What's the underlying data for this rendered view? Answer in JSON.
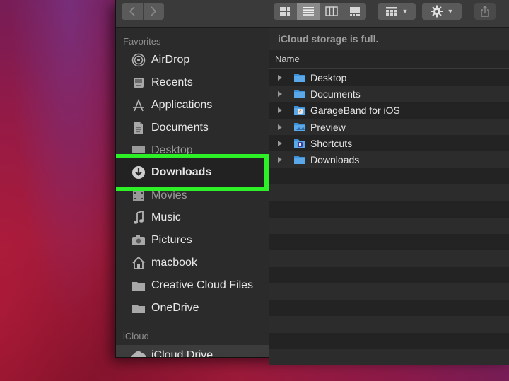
{
  "sidebar": {
    "favorites_title": "Favorites",
    "icloud_title": "iCloud",
    "items": [
      {
        "label": "AirDrop",
        "icon": "airdrop-icon"
      },
      {
        "label": "Recents",
        "icon": "recents-icon"
      },
      {
        "label": "Applications",
        "icon": "applications-icon"
      },
      {
        "label": "Documents",
        "icon": "documents-icon"
      },
      {
        "label": "Desktop",
        "icon": "desktop-icon"
      },
      {
        "label": "Downloads",
        "icon": "downloads-icon"
      },
      {
        "label": "Movies",
        "icon": "movies-icon"
      },
      {
        "label": "Music",
        "icon": "music-icon"
      },
      {
        "label": "Pictures",
        "icon": "pictures-icon"
      },
      {
        "label": "macbook",
        "icon": "home-icon"
      },
      {
        "label": "Creative Cloud Files",
        "icon": "folder-icon"
      },
      {
        "label": "OneDrive",
        "icon": "folder-icon"
      }
    ],
    "icloud_items": [
      {
        "label": "iCloud Drive",
        "icon": "icloud-icon"
      }
    ]
  },
  "main": {
    "banner": "iCloud storage is full.",
    "column_name": "Name",
    "files": [
      {
        "name": "Desktop",
        "icon": "blue-folder-icon"
      },
      {
        "name": "Documents",
        "icon": "blue-folder-icon"
      },
      {
        "name": "GarageBand for iOS",
        "icon": "garageband-folder-icon"
      },
      {
        "name": "Preview",
        "icon": "preview-folder-icon"
      },
      {
        "name": "Shortcuts",
        "icon": "shortcuts-folder-icon"
      },
      {
        "name": "Downloads",
        "icon": "blue-folder-icon"
      }
    ]
  },
  "colors": {
    "highlight": "#2ef026",
    "folder_blue": "#3d8fd6",
    "window_bg": "#262626"
  }
}
